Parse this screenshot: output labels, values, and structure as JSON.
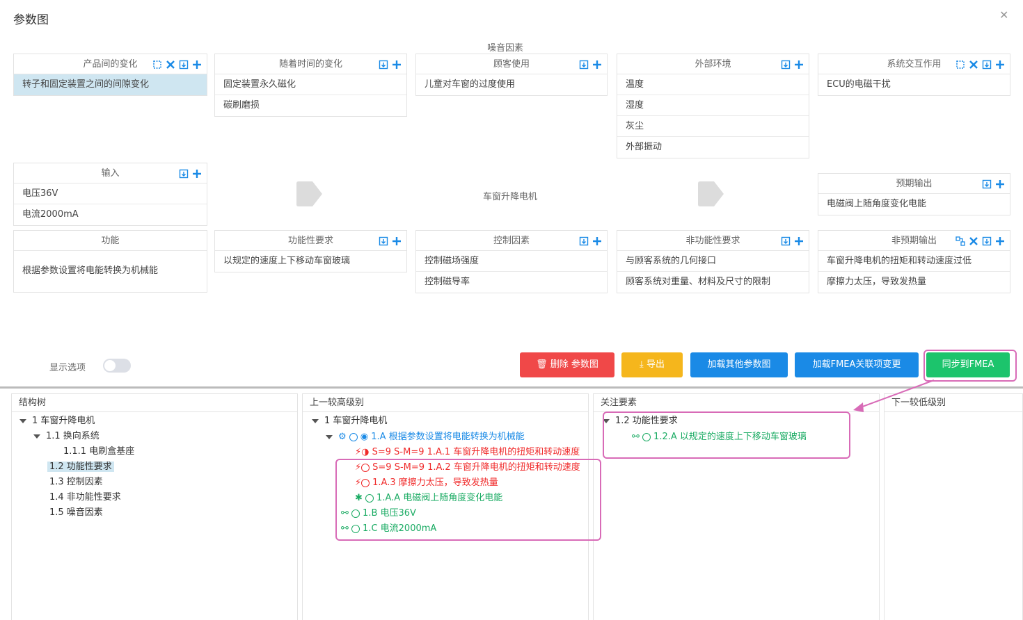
{
  "dialog": {
    "title": "参数图",
    "close_icon": "close-icon"
  },
  "noise_label": "噪音因素",
  "cards": {
    "product_var": {
      "title": "产品间的变化",
      "rows": [
        "转子和固定装置之间的间隙变化"
      ]
    },
    "time_var": {
      "title": "随着时间的变化",
      "rows": [
        "固定装置永久磁化",
        "碳刷磨损"
      ]
    },
    "customer_use": {
      "title": "顾客使用",
      "rows": [
        "儿童对车窗的过度使用"
      ]
    },
    "environment": {
      "title": "外部环境",
      "rows": [
        "温度",
        "湿度",
        "灰尘",
        "外部振动"
      ]
    },
    "system_interaction": {
      "title": "系统交互作用",
      "rows": [
        "ECU的电磁干扰"
      ]
    },
    "input": {
      "title": "输入",
      "rows": [
        "电压36V",
        "电流2000mA"
      ]
    },
    "expected_output": {
      "title": "预期输出",
      "rows": [
        "电磁阀上随角度变化电能"
      ]
    },
    "function": {
      "title": "功能",
      "rows": [
        "根据参数设置将电能转换为机械能"
      ]
    },
    "func_req": {
      "title": "功能性要求",
      "rows": [
        "以规定的速度上下移动车窗玻璃"
      ]
    },
    "control": {
      "title": "控制因素",
      "rows": [
        "控制磁场强度",
        "控制磁导率"
      ]
    },
    "nonfunc_req": {
      "title": "非功能性要求",
      "rows": [
        "与顾客系统的几何接口",
        "顾客系统对重量、材料及尺寸的限制"
      ]
    },
    "unexpected_output": {
      "title": "非预期输出",
      "rows": [
        "车窗升降电机的扭矩和转动速度过低",
        "摩擦力太压，导致发热量"
      ]
    }
  },
  "center_title": "车窗升降电机",
  "toggle": {
    "label": "显示选项"
  },
  "buttons": {
    "delete": "删除 参数图",
    "export": "导出",
    "load_other": "加载其他参数图",
    "load_fmea": "加载FMEA关联项变更",
    "sync": "同步到FMEA"
  },
  "panels": {
    "structure": {
      "title": "结构树",
      "nodes": [
        "1 车窗升降电机",
        "1.1 换向系统",
        "1.1.1 电刷盒基座",
        "1.2 功能性要求",
        "1.3 控制因素",
        "1.4 非功能性要求",
        "1.5 噪音因素"
      ]
    },
    "upper": {
      "title": "上一较高级别",
      "nodes": [
        "1 车窗升降电机",
        "1.A 根据参数设置将电能转换为机械能",
        "S=9 S-M=9 1.A.1 车窗升降电机的扭矩和转动速度",
        "S=9 S-M=9 1.A.2 车窗升降电机的扭矩和转动速度",
        "1.A.3 摩擦力太压，导致发热量",
        "1.A.A 电磁阀上随角度变化电能",
        "1.B 电压36V",
        "1.C 电流2000mA"
      ]
    },
    "focus": {
      "title": "关注要素",
      "nodes": [
        "1.2 功能性要求",
        "1.2.A 以规定的速度上下移动车窗玻璃"
      ]
    },
    "lower": {
      "title": "下一较低级别"
    }
  },
  "colors": {
    "accent": "#1a8ae6",
    "danger": "#f04848",
    "warning": "#f5b61c",
    "success": "#1cc46c",
    "highlight": "#d86bb7"
  }
}
